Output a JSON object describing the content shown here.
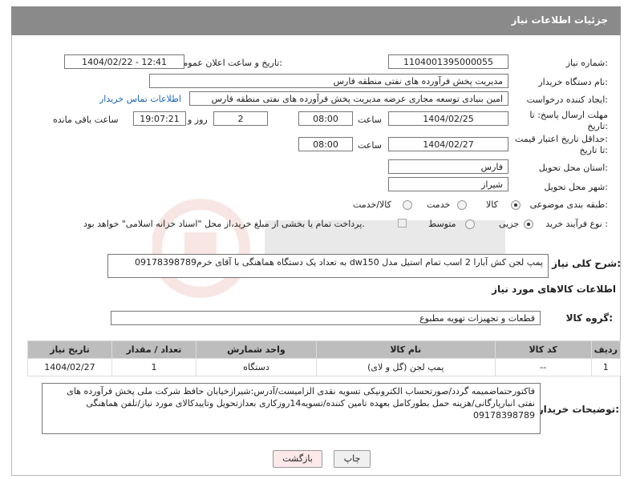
{
  "header": {
    "title": "جزئیات اطلاعات نیاز"
  },
  "need_number": {
    "label": "شماره نیاز:",
    "value": "1104001395000055"
  },
  "announce": {
    "label": "تاریخ و ساعت اعلان عمومی:",
    "value": "1404/02/22 - 12:41"
  },
  "buyer_org": {
    "label": "نام دستگاه خریدار:",
    "value": "مدیریت پخش فرآورده های نفتی منطقه فارس"
  },
  "creator": {
    "label": "ایجاد کننده درخواست:",
    "value": "امین بنیادی توسعه مجاری عرضه مدیریت پخش فرآورده های نفتی منطقه فارس",
    "contact_link": "اطلاعات تماس خریدار"
  },
  "deadline": {
    "label1": "مهلت ارسال پاسخ: تا",
    "label2": "تاریخ:",
    "date": "1404/02/25",
    "time_label": "ساعت",
    "time": "08:00",
    "days": "2",
    "days_label": "روز و",
    "remaining": "19:07:21",
    "remaining_label": "ساعت باقی مانده"
  },
  "price_validity": {
    "label1": "حداقل تاریخ اعتبار قیمت:",
    "label2": "تا تاریخ:",
    "date": "1404/02/27",
    "time_label": "ساعت",
    "time": "08:00"
  },
  "province": {
    "label": "استان محل تحویل:",
    "value": "فارس"
  },
  "city": {
    "label": "شهر محل تحویل:",
    "value": "شیراز"
  },
  "category": {
    "label": "طبقه بندی موضوعی:",
    "options": [
      "کالا",
      "خدمت",
      "کالا/خدمت"
    ]
  },
  "purchase_type": {
    "label": "نوع فرآیند خرید :",
    "options": [
      "جزیی",
      "متوسط"
    ],
    "note": "پرداخت تمام یا بخشی از مبلغ خرید،از محل \"اسناد خزانه اسلامی\" خواهد بود."
  },
  "description": {
    "label": "شرح کلی نیاز:",
    "value": "پمپ لجن کش آبارا 2 اسب تمام استیل مدل dw150 به تعداد یک دستگاه هماهنگی با آقای خرم09178398789"
  },
  "goods_info": {
    "title": "اطلاعات کالاهای مورد نیاز"
  },
  "goods_group": {
    "label": "گروه کالا:",
    "value": "قطعات و تجهیزات تهویه مطبوع"
  },
  "table": {
    "headers": [
      "ردیف",
      "کد کالا",
      "نام کالا",
      "واحد شمارش",
      "تعداد / مقدار",
      "تاریخ نیاز"
    ],
    "rows": [
      [
        "1",
        "--",
        "پمپ لجن (گل و لای)",
        "دستگاه",
        "1",
        "1404/02/27"
      ]
    ]
  },
  "buyer_notes": {
    "label": "توضیحات خریدار:",
    "value": "فاکتورحتماضمیمه گردد/صورتحساب الکترونیکی تسویه نقدی الزامیست/آدرس:شیرازخیابان حافظ شرکت ملی پخش فرآورده های نفتی انبارپارگانی/هزینه حمل بطورکامل بعهده تامین کننده/تسویه14روزکاری بعدازتحویل وتاییدکالای مورد نیاز/تلفن هماهنگی 09178398789"
  },
  "buttons": {
    "print": "چاپ",
    "back": "بازگشت"
  }
}
